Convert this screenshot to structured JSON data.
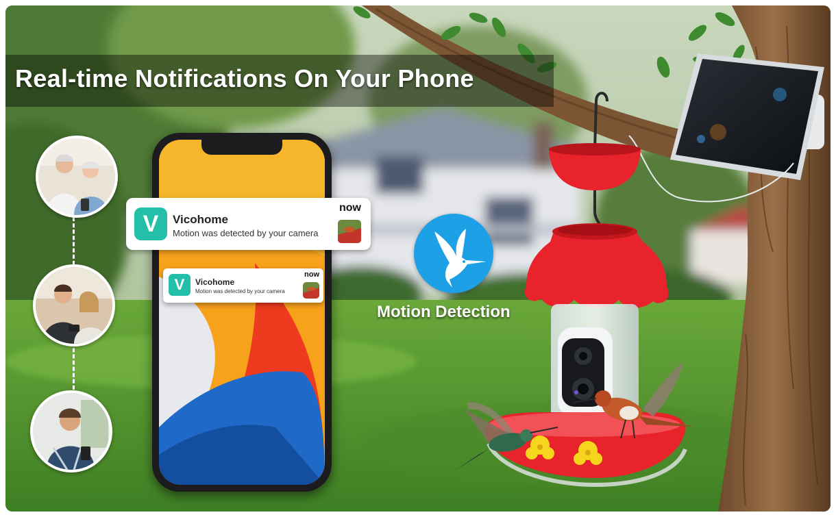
{
  "banner": {
    "title": "Real-time Notifications On Your Phone"
  },
  "notifications": [
    {
      "app_name": "Vicohome",
      "message": "Motion was detected by your camera",
      "time": "now",
      "app_icon_glyph": "V"
    },
    {
      "app_name": "Vicohome",
      "message": "Motion was detected by your camera",
      "time": "now",
      "app_icon_glyph": "V"
    }
  ],
  "motion": {
    "label": "Motion Detection",
    "icon": "hummingbird-icon"
  },
  "colors": {
    "app_teal": "#23bfa9",
    "motion_blue": "#1ea0e6",
    "feeder_red": "#e8232b",
    "flower_yellow": "#f6d51d"
  }
}
